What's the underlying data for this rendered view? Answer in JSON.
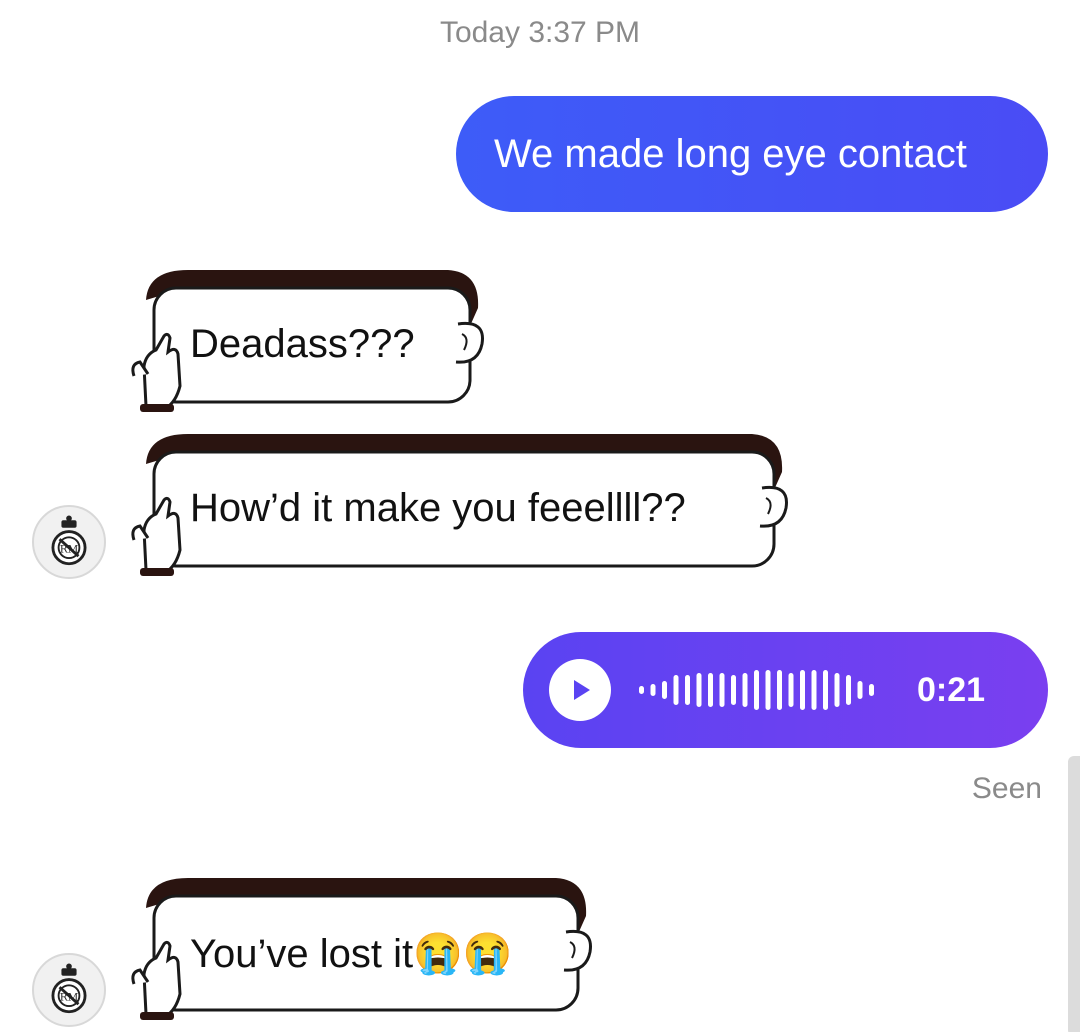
{
  "timestamp": "Today 3:37 PM",
  "messages": {
    "m1": {
      "text": "We made long eye contact"
    },
    "m2": {
      "text": "Deadass???"
    },
    "m3": {
      "text": "How’d it make you feeellll??"
    },
    "m4": {
      "duration": "0:21"
    },
    "m5": {
      "text": "You’ve lost it",
      "emoji": "😭😭"
    }
  },
  "status": {
    "seen": "Seen"
  },
  "colors": {
    "outgoing": "#4a4cf5",
    "voice": "#6b41f1",
    "meta_text": "#8a8a8a",
    "sticker_hair": "#2a1410"
  },
  "icons": {
    "avatar": "real-madrid-crest-icon",
    "play": "play-icon",
    "hand": "hand-cartoon-icon"
  }
}
